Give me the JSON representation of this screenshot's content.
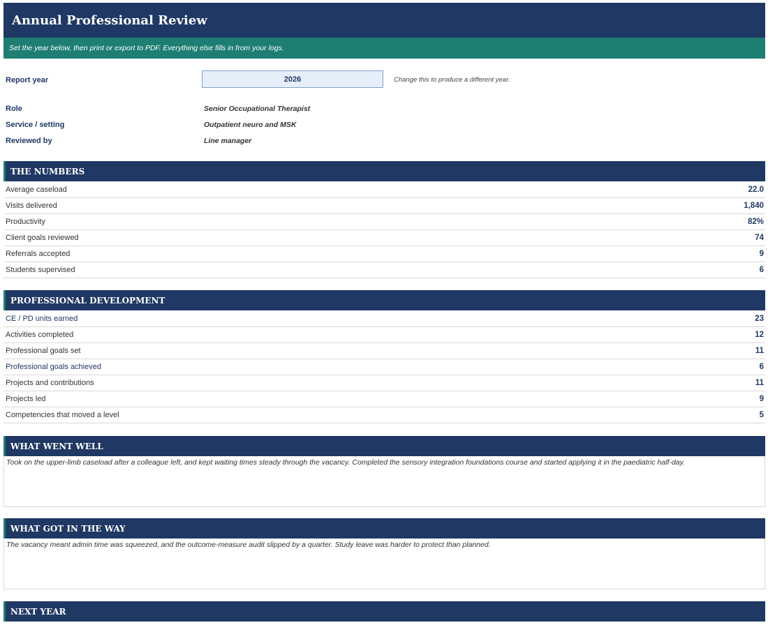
{
  "header": {
    "title": "Annual Professional Review",
    "subtitle": "Set the year below, then print or export to PDF. Everything else fills in from your logs."
  },
  "fields": {
    "report_year_label": "Report year",
    "report_year_value": "2026",
    "report_year_hint": "Change this to produce a different year.",
    "role_label": "Role",
    "role_value": "Senior Occupational Therapist",
    "service_label": "Service / setting",
    "service_value": "Outpatient neuro and MSK",
    "reviewed_label": "Reviewed by",
    "reviewed_value": "Line manager"
  },
  "numbers": {
    "heading": "THE NUMBERS",
    "rows": [
      {
        "label": "Average caseload",
        "value": "22.0"
      },
      {
        "label": "Visits delivered",
        "value": "1,840"
      },
      {
        "label": "Productivity",
        "value": "82%"
      },
      {
        "label": "Client goals reviewed",
        "value": "74"
      },
      {
        "label": "Referrals accepted",
        "value": "9"
      },
      {
        "label": "Students supervised",
        "value": "6"
      }
    ]
  },
  "development": {
    "heading": "PROFESSIONAL DEVELOPMENT",
    "rows": [
      {
        "label": "CE / PD units earned",
        "value": "23"
      },
      {
        "label": "Activities completed",
        "value": "12"
      },
      {
        "label": "Professional goals set",
        "value": "11"
      },
      {
        "label": "Professional goals achieved",
        "value": "6"
      },
      {
        "label": "Projects and contributions",
        "value": "11"
      },
      {
        "label": "Projects led",
        "value": "9"
      },
      {
        "label": "Competencies that moved a level",
        "value": "5"
      }
    ]
  },
  "went_well": {
    "heading": "WHAT WENT WELL",
    "text": "Took on the upper-limb caseload after a colleague left, and kept waiting times steady through the vacancy. Completed the sensory integration foundations course and started applying it in the paediatric half-day."
  },
  "got_in_way": {
    "heading": "WHAT GOT IN THE WAY",
    "text": "The vacancy meant admin time was squeezed, and the outcome-measure audit slipped by a quarter. Study leave was harder to protect than planned."
  },
  "next_year": {
    "heading": "NEXT YEAR"
  }
}
